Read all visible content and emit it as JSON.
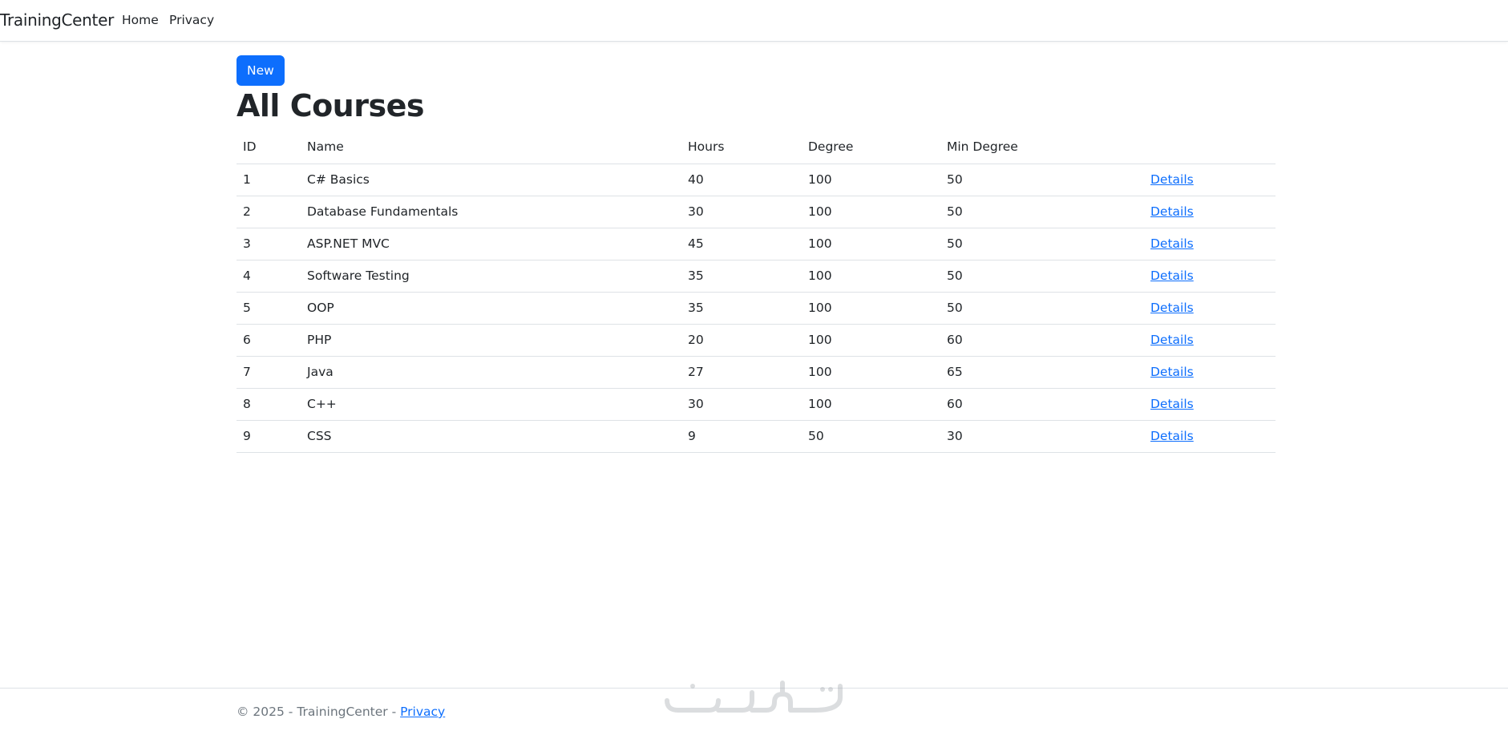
{
  "navbar": {
    "brand": "TrainingCenter",
    "links": [
      {
        "label": "Home"
      },
      {
        "label": "Privacy"
      }
    ]
  },
  "main": {
    "new_button_label": "New",
    "title": "All Courses",
    "table": {
      "headers": [
        "ID",
        "Name",
        "Hours",
        "Degree",
        "Min Degree",
        ""
      ],
      "rows": [
        {
          "id": "1",
          "name": "C# Basics",
          "hours": "40",
          "degree": "100",
          "min_degree": "50",
          "action": "Details"
        },
        {
          "id": "2",
          "name": "Database Fundamentals",
          "hours": "30",
          "degree": "100",
          "min_degree": "50",
          "action": "Details"
        },
        {
          "id": "3",
          "name": "ASP.NET MVC",
          "hours": "45",
          "degree": "100",
          "min_degree": "50",
          "action": "Details"
        },
        {
          "id": "4",
          "name": "Software Testing",
          "hours": "35",
          "degree": "100",
          "min_degree": "50",
          "action": "Details"
        },
        {
          "id": "5",
          "name": "OOP",
          "hours": "35",
          "degree": "100",
          "min_degree": "50",
          "action": "Details"
        },
        {
          "id": "6",
          "name": "PHP",
          "hours": "20",
          "degree": "100",
          "min_degree": "60",
          "action": "Details"
        },
        {
          "id": "7",
          "name": "Java",
          "hours": "27",
          "degree": "100",
          "min_degree": "65",
          "action": "Details"
        },
        {
          "id": "8",
          "name": "C++",
          "hours": "30",
          "degree": "100",
          "min_degree": "60",
          "action": "Details"
        },
        {
          "id": "9",
          "name": "CSS",
          "hours": "9",
          "degree": "50",
          "min_degree": "30",
          "action": "Details"
        }
      ]
    }
  },
  "footer": {
    "text": "© 2025 - TrainingCenter - ",
    "link_label": "Privacy"
  },
  "watermark": {
    "text": "خمسات",
    "icon": "watermark-logo-icon"
  },
  "colors": {
    "primary": "#0d6efd",
    "text": "#212529",
    "muted": "#6c757d",
    "border": "#dee2e6"
  }
}
